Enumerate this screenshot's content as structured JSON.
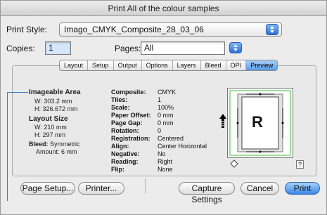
{
  "window": {
    "title": "Print All of the colour samples"
  },
  "print_style": {
    "label": "Print Style:",
    "value": "Imago_CMYK_Composite_28_03_06"
  },
  "copies": {
    "label": "Copies:",
    "value": "1"
  },
  "pages": {
    "label": "Pages:",
    "value": "All"
  },
  "tabs": [
    {
      "label": "Layout"
    },
    {
      "label": "Setup"
    },
    {
      "label": "Output"
    },
    {
      "label": "Options"
    },
    {
      "label": "Layers"
    },
    {
      "label": "Bleed"
    },
    {
      "label": "OPI"
    },
    {
      "label": "Preview"
    }
  ],
  "imageable_area": {
    "title": "Imageable Area",
    "width": "W: 303.2 mm",
    "height": "H: 326.672 mm"
  },
  "layout_size": {
    "title": "Layout Size",
    "width": "W: 210 mm",
    "height": "H: 297 mm"
  },
  "bleed": {
    "label": "Bleed:",
    "value": "Symmetric",
    "amount": "Amount: 6 mm"
  },
  "details": [
    {
      "key": "Composite:",
      "value": "CMYK"
    },
    {
      "key": "Tiles:",
      "value": "1"
    },
    {
      "key": "Scale:",
      "value": "100%"
    },
    {
      "key": "Paper Offset:",
      "value": "0 mm"
    },
    {
      "key": "Page Gap:",
      "value": "0 mm"
    },
    {
      "key": "Rotation:",
      "value": "0"
    },
    {
      "key": "Registration:",
      "value": "Centered"
    },
    {
      "key": "Align:",
      "value": "Center Horizontal"
    },
    {
      "key": "Negative:",
      "value": "No"
    },
    {
      "key": "Reading:",
      "value": "Right"
    },
    {
      "key": "Flip:",
      "value": "None"
    }
  ],
  "preview": {
    "glyph": "R",
    "help": "?"
  },
  "buttons": {
    "page_setup": "Page Setup...",
    "printer": "Printer...",
    "capture": "Capture Settings",
    "cancel": "Cancel",
    "print": "Print"
  },
  "colors": {
    "accent": "#3b86e6",
    "callout": "#3a7ac8"
  }
}
